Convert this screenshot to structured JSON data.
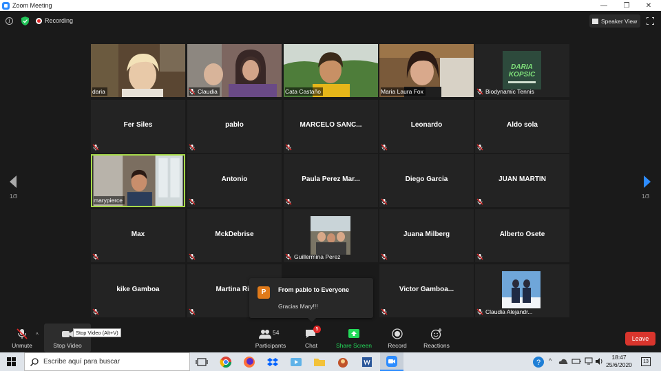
{
  "window": {
    "title": "Zoom Meeting"
  },
  "topbar": {
    "recording_label": "Recording",
    "speaker_view_label": "Speaker View"
  },
  "grid": {
    "tiles": [
      {
        "name": "daria",
        "kind": "video"
      },
      {
        "name": "Claudia",
        "kind": "video",
        "muted": true
      },
      {
        "name": "Cata Castaño",
        "kind": "video"
      },
      {
        "name": "Maria Laura Fox",
        "kind": "video"
      },
      {
        "name": "Biodynamic Tennis",
        "kind": "logo",
        "muted": true
      },
      {
        "name": "Fer Siles",
        "kind": "name",
        "muted": true
      },
      {
        "name": "pablo",
        "kind": "name",
        "muted": true
      },
      {
        "name": "MARCELO  SANC...",
        "kind": "name",
        "muted": true
      },
      {
        "name": "Leonardo",
        "kind": "name",
        "muted": true
      },
      {
        "name": "Aldo sola",
        "kind": "name",
        "muted": true
      },
      {
        "name": "marypierce",
        "kind": "video",
        "active": true
      },
      {
        "name": "Antonio",
        "kind": "name",
        "muted": true
      },
      {
        "name": "Paula  Perez  Mar...",
        "kind": "name",
        "muted": true
      },
      {
        "name": "Diego Garcia",
        "kind": "name",
        "muted": true
      },
      {
        "name": "JUAN MARTIN",
        "kind": "name",
        "muted": true
      },
      {
        "name": "Max",
        "kind": "name",
        "muted": true
      },
      {
        "name": "MckDebrise",
        "kind": "name",
        "muted": true
      },
      {
        "name": "Guillermina Perez",
        "kind": "photo",
        "muted": true
      },
      {
        "name": "Juana Milberg",
        "kind": "name",
        "muted": true
      },
      {
        "name": "Alberto Osete",
        "kind": "name",
        "muted": true
      },
      {
        "name": "kike Gamboa",
        "kind": "name",
        "muted": true
      },
      {
        "name": "Martina Riv",
        "kind": "name",
        "muted": true
      },
      {
        "name": "",
        "kind": "hidden"
      },
      {
        "name": "Victor  Gamboa...",
        "kind": "name",
        "muted": true
      },
      {
        "name": "Claudia Alejandr...",
        "kind": "photo",
        "muted": true
      }
    ],
    "logo_text_1": "DARIA",
    "logo_text_2": "KOPSIC"
  },
  "pagination": {
    "left": "1/3",
    "right": "1/3"
  },
  "chat_popup": {
    "avatar_letter": "P",
    "from": "From pablo to Everyone",
    "message": "Gracias Mary!!!"
  },
  "toolbar": {
    "unmute": "Unmute",
    "stop_video": "Stop Video",
    "tooltip": "Stop Video (Alt+V)",
    "participants": "Participants",
    "participants_count": "54",
    "chat": "Chat",
    "chat_badge": "5",
    "share_screen": "Share Screen",
    "record": "Record",
    "reactions": "Reactions",
    "leave": "Leave"
  },
  "taskbar": {
    "search_placeholder": "Escribe aquí para buscar",
    "time": "18:47",
    "date": "25/6/2020",
    "notifications": "13"
  },
  "colors": {
    "accent": "#2d8cff",
    "share": "#23d959",
    "leave": "#d9352d",
    "active_border": "#a6d94a"
  }
}
